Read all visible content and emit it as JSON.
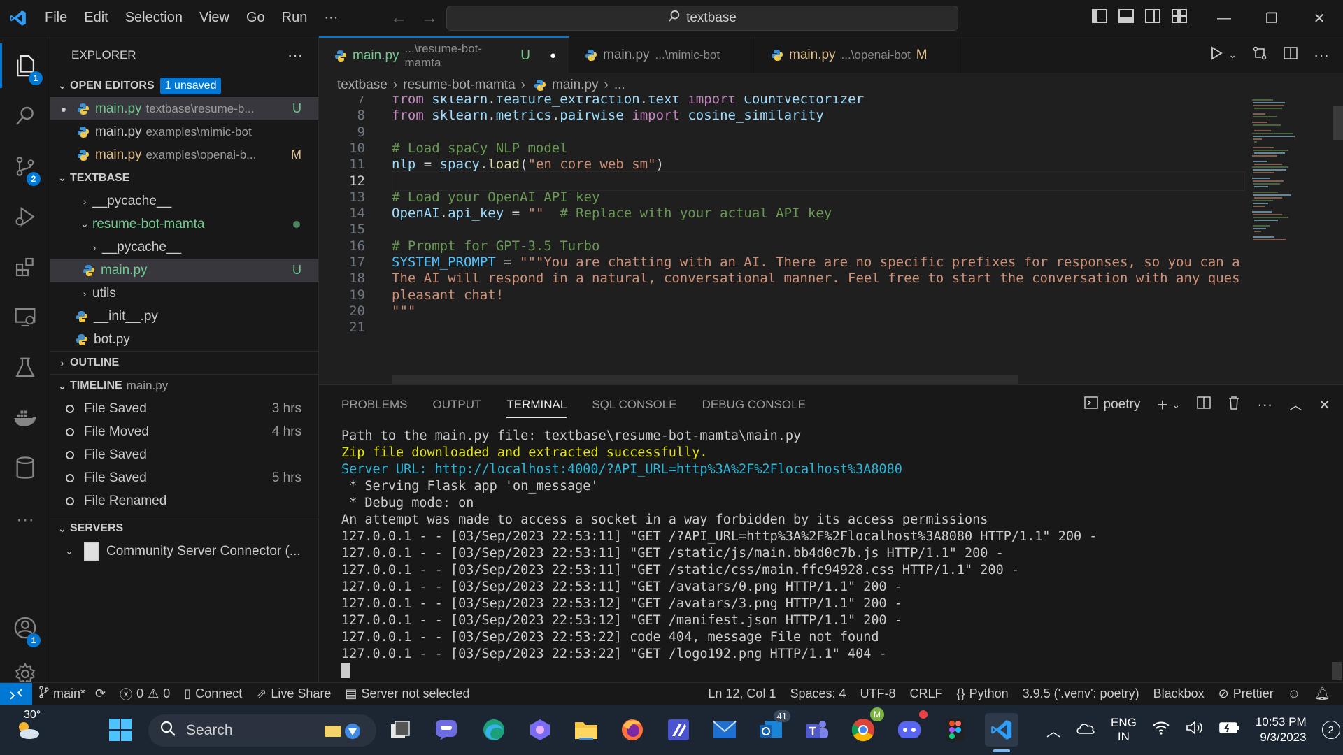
{
  "titlebar": {
    "menu": [
      "File",
      "Edit",
      "Selection",
      "View",
      "Go",
      "Run",
      "···"
    ],
    "search_text": "textbase"
  },
  "activity": {
    "explorer_badge": "1",
    "scm_badge": "2",
    "accounts_badge": "1"
  },
  "sidebar": {
    "title": "EXPLORER",
    "more": "···",
    "open_editors": {
      "label": "OPEN EDITORS",
      "badge": "1 unsaved",
      "items": [
        {
          "name": "main.py",
          "path": "textbase\\resume-b...",
          "flag": "U"
        },
        {
          "name": "main.py",
          "path": "examples\\mimic-bot",
          "flag": ""
        },
        {
          "name": "main.py",
          "path": "examples\\openai-b...",
          "flag": "M"
        }
      ]
    },
    "textbase": {
      "label": "TEXTBASE",
      "pycache1": "__pycache__",
      "resume_folder": "resume-bot-mamta",
      "pycache2": "__pycache__",
      "main_py": "main.py",
      "main_flag": "U",
      "utils": "utils",
      "init_py": "__init__.py",
      "bot_py": "bot.py"
    },
    "outline": "OUTLINE",
    "timeline": {
      "label": "TIMELINE",
      "file": "main.py",
      "items": [
        {
          "event": "File Saved",
          "time": "3 hrs"
        },
        {
          "event": "File Moved",
          "time": "4 hrs"
        },
        {
          "event": "File Saved",
          "time": ""
        },
        {
          "event": "File Saved",
          "time": "5 hrs"
        },
        {
          "event": "File Renamed",
          "time": ""
        }
      ]
    },
    "servers": {
      "label": "SERVERS",
      "item": "Community Server Connector (..."
    }
  },
  "tabs": [
    {
      "name": "main.py",
      "path": "...\\resume-bot-mamta",
      "flag": "U",
      "dirty": "●"
    },
    {
      "name": "main.py",
      "path": "...\\mimic-bot",
      "flag": "",
      "dirty": ""
    },
    {
      "name": "main.py",
      "path": "...\\openai-bot",
      "flag": "M",
      "dirty": ""
    }
  ],
  "breadcrumb": [
    "textbase",
    "resume-bot-mamta",
    "main.py",
    "..."
  ],
  "editor": {
    "current_line": 12,
    "lines": [
      {
        "n": "7",
        "text": "from sklearn.feature_extraction.text import CountVectorizer"
      },
      {
        "n": "8",
        "text": "from sklearn.metrics.pairwise import cosine_similarity"
      },
      {
        "n": "9",
        "text": ""
      },
      {
        "n": "10",
        "text": "# Load spaCy NLP model"
      },
      {
        "n": "11",
        "text": "nlp = spacy.load(\"en_core_web_sm\")"
      },
      {
        "n": "12",
        "text": ""
      },
      {
        "n": "13",
        "text": "# Load your OpenAI API key"
      },
      {
        "n": "14",
        "text": "OpenAI.api_key = \"\"  # Replace with your actual API key"
      },
      {
        "n": "15",
        "text": ""
      },
      {
        "n": "16",
        "text": "# Prompt for GPT-3.5 Turbo"
      },
      {
        "n": "17",
        "text": "SYSTEM_PROMPT = \"\"\"You are chatting with an AI. There are no specific prefixes for responses, so you can a"
      },
      {
        "n": "18",
        "text": "The AI will respond in a natural, conversational manner. Feel free to start the conversation with any ques"
      },
      {
        "n": "19",
        "text": "pleasant chat!"
      },
      {
        "n": "20",
        "text": "\"\"\""
      },
      {
        "n": "21",
        "text": ""
      }
    ]
  },
  "panel": {
    "tabs": [
      "PROBLEMS",
      "OUTPUT",
      "TERMINAL",
      "SQL CONSOLE",
      "DEBUG CONSOLE"
    ],
    "active_tab": "TERMINAL",
    "shell": "poetry",
    "terminal_lines": [
      {
        "text": "Path to the main.py file: textbase\\resume-bot-mamta\\main.py",
        "color": "#cccccc"
      },
      {
        "text": "Zip file downloaded and extracted successfully.",
        "color": "#e5e510"
      },
      {
        "text": "Server URL: http://localhost:4000/?API_URL=http%3A%2F%2Flocalhost%3A8080",
        "color": "#29b8db"
      },
      {
        "text": " * Serving Flask app 'on_message'",
        "color": "#cccccc"
      },
      {
        "text": " * Debug mode: on",
        "color": "#cccccc"
      },
      {
        "text": "An attempt was made to access a socket in a way forbidden by its access permissions",
        "color": "#cccccc"
      },
      {
        "text": "127.0.0.1 - - [03/Sep/2023 22:53:11] \"GET /?API_URL=http%3A%2F%2Flocalhost%3A8080 HTTP/1.1\" 200 -",
        "color": "#cccccc"
      },
      {
        "text": "127.0.0.1 - - [03/Sep/2023 22:53:11] \"GET /static/js/main.bb4d0c7b.js HTTP/1.1\" 200 -",
        "color": "#cccccc"
      },
      {
        "text": "127.0.0.1 - - [03/Sep/2023 22:53:11] \"GET /static/css/main.ffc94928.css HTTP/1.1\" 200 -",
        "color": "#cccccc"
      },
      {
        "text": "127.0.0.1 - - [03/Sep/2023 22:53:11] \"GET /avatars/0.png HTTP/1.1\" 200 -",
        "color": "#cccccc"
      },
      {
        "text": "127.0.0.1 - - [03/Sep/2023 22:53:12] \"GET /avatars/3.png HTTP/1.1\" 200 -",
        "color": "#cccccc"
      },
      {
        "text": "127.0.0.1 - - [03/Sep/2023 22:53:12] \"GET /manifest.json HTTP/1.1\" 200 -",
        "color": "#cccccc"
      },
      {
        "text": "127.0.0.1 - - [03/Sep/2023 22:53:22] code 404, message File not found",
        "color": "#cccccc"
      },
      {
        "text": "127.0.0.1 - - [03/Sep/2023 22:53:22] \"GET /logo192.png HTTP/1.1\" 404 -",
        "color": "#cccccc"
      }
    ]
  },
  "statusbar": {
    "branch": "main*",
    "errors": "0",
    "warnings": "0",
    "connect": "Connect",
    "live_share": "Live Share",
    "server": "Server not selected",
    "position": "Ln 12, Col 1",
    "spaces": "Spaces: 4",
    "encoding": "UTF-8",
    "eol": "CRLF",
    "language": "Python",
    "interpreter": "3.9.5 ('.venv': poetry)",
    "blackbox": "Blackbox",
    "prettier": "Prettier"
  },
  "taskbar": {
    "weather": "30°",
    "search": "Search",
    "teams_badge": "41",
    "lang": "ENG",
    "region": "IN",
    "time": "10:53 PM",
    "date": "9/3/2023",
    "notif_badge": "2"
  },
  "colors": {
    "accent": "#0078d4",
    "untracked": "#73c991",
    "modified": "#e2c08d"
  }
}
